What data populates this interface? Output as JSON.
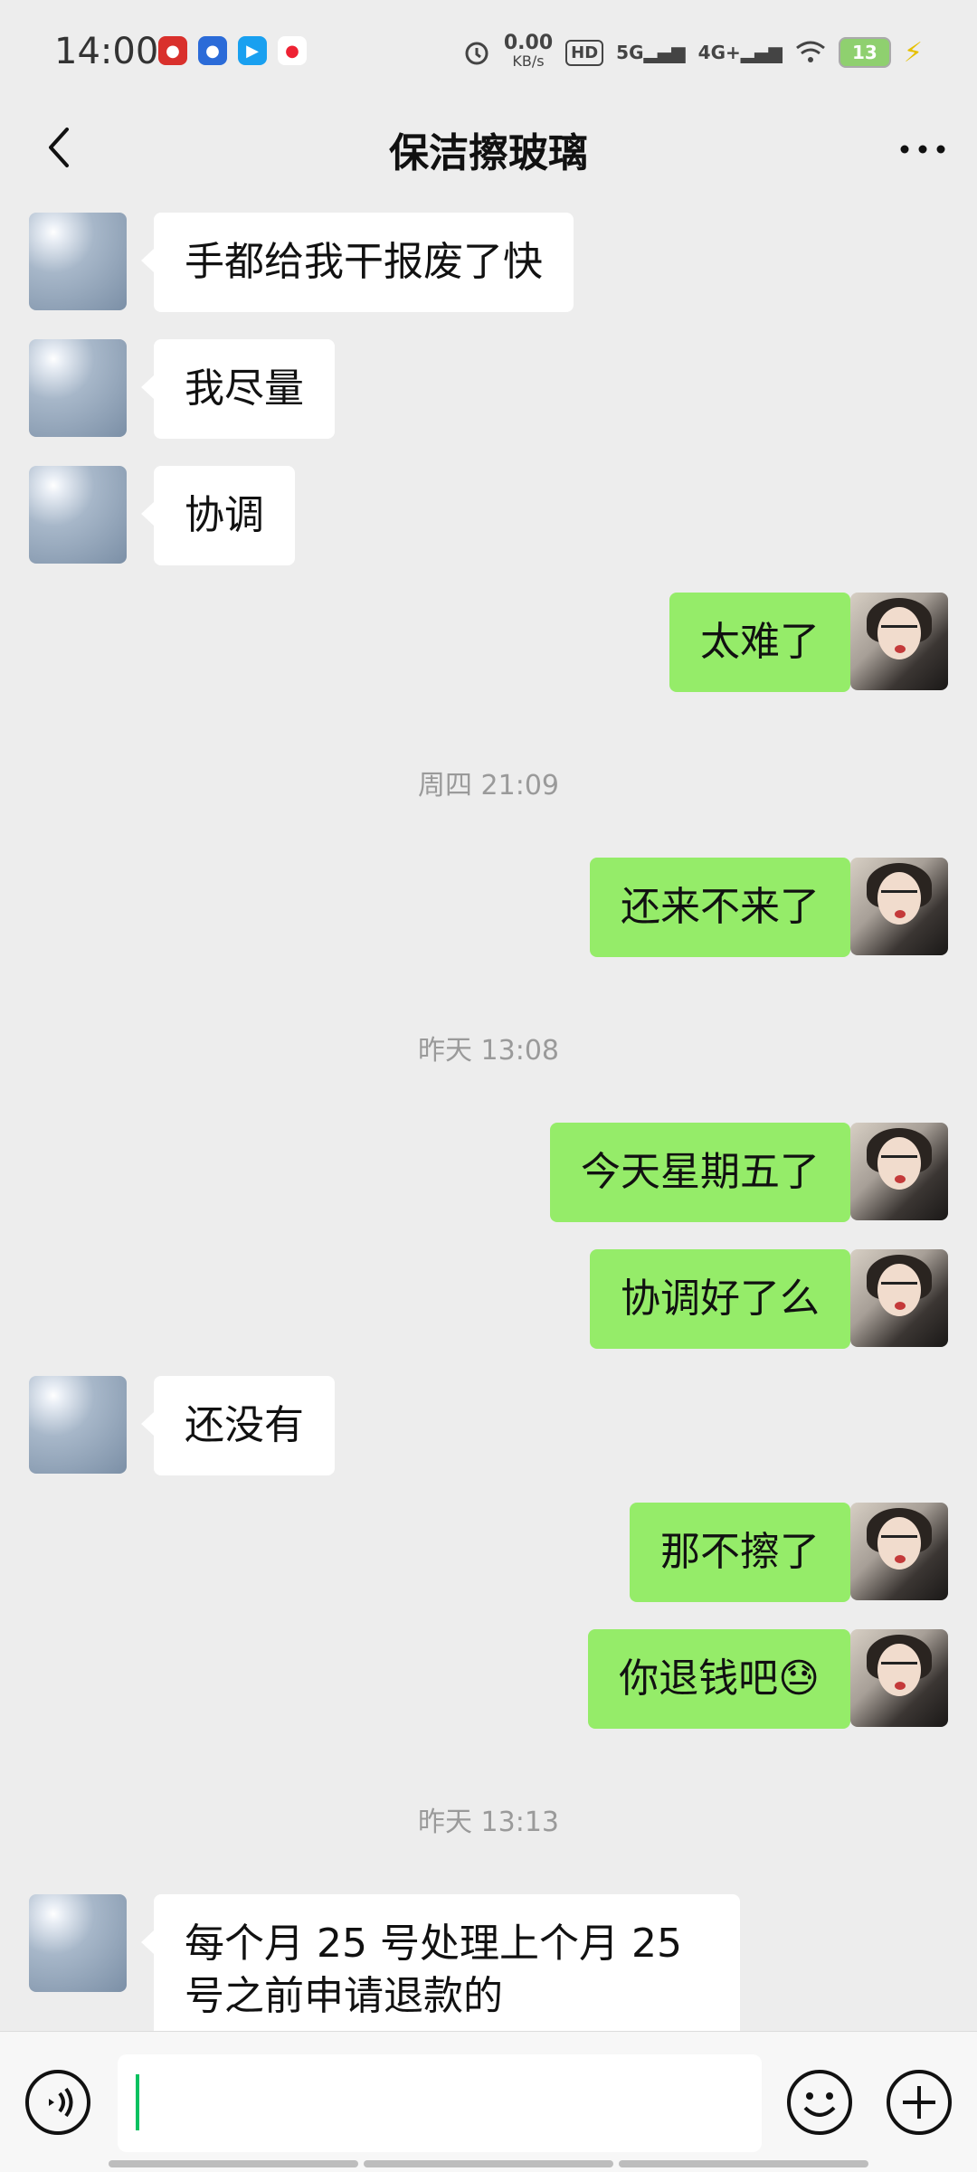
{
  "status_bar": {
    "time": "14:00",
    "net_speed_value": "0.00",
    "net_speed_unit": "KB/s",
    "hd": "HD",
    "signal_5g": "5G",
    "signal_4g": "4G+",
    "battery": "13"
  },
  "header": {
    "title": "保洁擦玻璃"
  },
  "messages": [
    {
      "side": "left",
      "text": "手都给我干报废了快"
    },
    {
      "side": "left",
      "text": "我尽量"
    },
    {
      "side": "left",
      "text": "协调"
    },
    {
      "side": "right",
      "text": "太难了"
    },
    {
      "type": "time",
      "text": "周四 21:09"
    },
    {
      "side": "right",
      "text": "还来不来了"
    },
    {
      "type": "time",
      "text": "昨天 13:08"
    },
    {
      "side": "right",
      "text": "今天星期五了"
    },
    {
      "side": "right",
      "text": "协调好了么"
    },
    {
      "side": "left",
      "text": "还没有"
    },
    {
      "side": "right",
      "text": "那不擦了"
    },
    {
      "side": "right",
      "text": "你退钱吧😓"
    },
    {
      "type": "time",
      "text": "昨天 13:13"
    },
    {
      "side": "left",
      "text": "每个月 25 号处理上个月 25 号之前申请退款的"
    }
  ],
  "input": {
    "value": "",
    "placeholder": ""
  },
  "colors": {
    "background": "#ededed",
    "sent_bubble": "#95ec69",
    "received_bubble": "#ffffff",
    "cursor": "#07c160"
  },
  "icons": [
    "back-arrow-icon",
    "more-dots-icon",
    "voice-icon",
    "emoji-icon",
    "plus-icon",
    "alarm-icon",
    "wifi-icon",
    "signal-icon",
    "battery-icon",
    "charging-bolt-icon"
  ]
}
